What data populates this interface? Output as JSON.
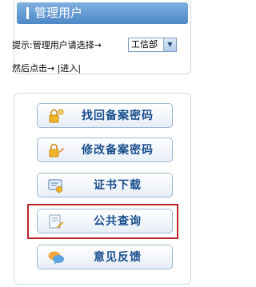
{
  "panel": {
    "title": "管理用户",
    "hint": "提示:管理用户请选择→",
    "dept_selected": "工信部",
    "then_text": "然后点击→",
    "enter_link": "|进入|"
  },
  "buttons": [
    {
      "label": "找回备案密码",
      "icon": "key-icon"
    },
    {
      "label": "修改备案密码",
      "icon": "key-edit-icon"
    },
    {
      "label": "证书下载",
      "icon": "certificate-download-icon"
    },
    {
      "label": "公共查询",
      "icon": "public-query-icon"
    },
    {
      "label": "意见反馈",
      "icon": "feedback-chat-icon"
    }
  ],
  "colors": {
    "header_blue": "#5b93cc",
    "button_text": "#1a4e8c",
    "highlight_red": "#c0262e"
  }
}
